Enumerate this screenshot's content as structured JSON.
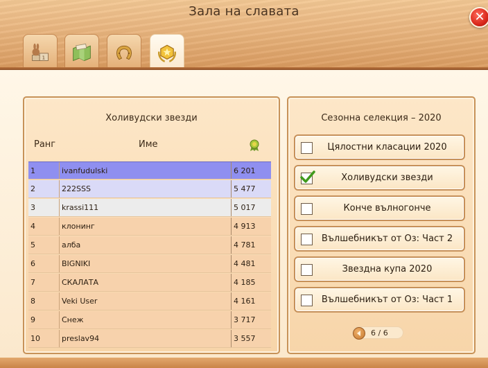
{
  "window": {
    "title": "Зала на славата",
    "close_label": "✕"
  },
  "tabs": [
    {
      "icon": "podium-rabbit-icon",
      "active": false
    },
    {
      "icon": "map-icon",
      "active": false
    },
    {
      "icon": "horseshoe-icon",
      "active": false
    },
    {
      "icon": "hall-of-fame-badge-icon",
      "active": true
    }
  ],
  "leaderboard": {
    "title": "Холивудски звезди",
    "col_rank": "Ранг",
    "col_name": "Име",
    "col_score_icon": "award-medal-icon",
    "rows": [
      {
        "rank": "1",
        "name": "ivanfudulski",
        "score": "6 201"
      },
      {
        "rank": "2",
        "name": "222SSS",
        "score": "5 477"
      },
      {
        "rank": "3",
        "name": "krassi111",
        "score": "5 017"
      },
      {
        "rank": "4",
        "name": "клонинг",
        "score": "4 913"
      },
      {
        "rank": "5",
        "name": "алба",
        "score": "4 781"
      },
      {
        "rank": "6",
        "name": "BIGNIKI",
        "score": "4 481"
      },
      {
        "rank": "7",
        "name": "СКАЛАТА",
        "score": "4 185"
      },
      {
        "rank": "8",
        "name": "Veki User",
        "score": "4 161"
      },
      {
        "rank": "9",
        "name": "Снеж",
        "score": "3 717"
      },
      {
        "rank": "10",
        "name": "preslav94",
        "score": "3 557"
      }
    ]
  },
  "season": {
    "title": "Сезонна селекция – 2020",
    "items": [
      {
        "label": "Цялостни класации 2020",
        "checked": false
      },
      {
        "label": "Холивудски звезди",
        "checked": true
      },
      {
        "label": "Конче вълногонче",
        "checked": false
      },
      {
        "label": "Вълшебникът от Оз: Част 2",
        "checked": false
      },
      {
        "label": "Звездна купа 2020",
        "checked": false
      },
      {
        "label": "Вълшебникът от Оз: Част 1",
        "checked": false
      }
    ],
    "pager": {
      "text": "6 / 6",
      "prev_icon": "arrow-left-icon"
    }
  },
  "colors": {
    "row_highlight_1": "#8f8ff0",
    "row_highlight_2": "#dadaf7",
    "row_highlight_3": "#ececec",
    "row_default": "#f7d2ac",
    "check_green": "#3f9a1c"
  }
}
